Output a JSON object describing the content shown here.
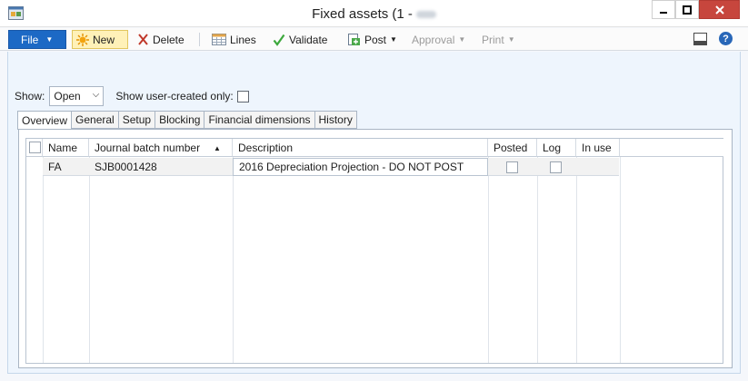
{
  "window": {
    "title": "Fixed assets (1 -"
  },
  "toolbar": {
    "file": "File",
    "new": "New",
    "delete": "Delete",
    "lines": "Lines",
    "validate": "Validate",
    "post": "Post",
    "approval": "Approval",
    "print": "Print"
  },
  "filter": {
    "show_label": "Show:",
    "show_value": "Open",
    "user_created_label": "Show user-created only:"
  },
  "tabs": [
    "Overview",
    "General",
    "Setup",
    "Blocking",
    "Financial dimensions",
    "History"
  ],
  "grid": {
    "columns": [
      "Name",
      "Journal batch number",
      "Description",
      "Posted",
      "Log",
      "In use"
    ],
    "rows": [
      {
        "name": "FA",
        "journal_batch_number": "SJB0001428",
        "description": "2016 Depreciation Projection - DO NOT POST"
      }
    ]
  },
  "colors": {
    "file_button": "#1c69c5",
    "new_highlight": "#fff1b8",
    "close_button": "#c7463d",
    "content_background": "#eef5fd"
  }
}
